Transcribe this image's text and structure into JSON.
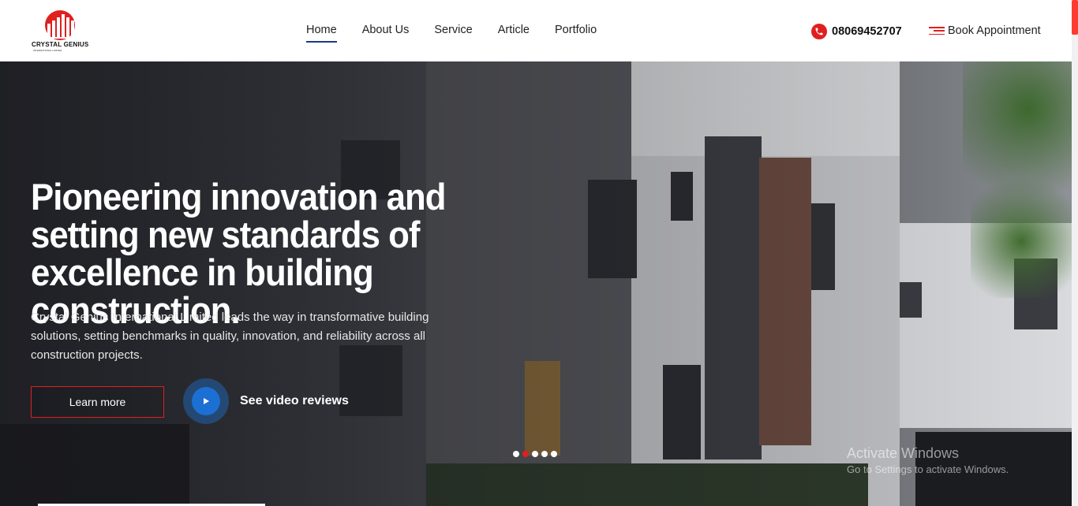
{
  "header": {
    "logo_name": "CRYSTAL GENIUS",
    "logo_sub": "INTERNATIONAL LIMITED",
    "nav": [
      {
        "label": "Home",
        "active": true
      },
      {
        "label": "About Us"
      },
      {
        "label": "Service"
      },
      {
        "label": "Article"
      },
      {
        "label": "Portfolio"
      }
    ],
    "phone": "08069452707",
    "book_label": "Book Appointment"
  },
  "hero": {
    "headline": "Pioneering innovation and setting new standards of excellence in building construction.",
    "subtext": "Crystal Genius International Limited leads the way in transformative building solutions, setting benchmarks in quality, innovation, and reliability across all construction projects.",
    "learn_more": "Learn more",
    "video_label": "See video reviews",
    "slides": 5,
    "active_slide": 2
  },
  "watermark": {
    "title": "Activate Windows",
    "subtitle": "Go to Settings to activate Windows."
  },
  "colors": {
    "accent": "#e01f1f",
    "play": "#1c6fd3",
    "nav_underline": "#1a3a8a"
  }
}
